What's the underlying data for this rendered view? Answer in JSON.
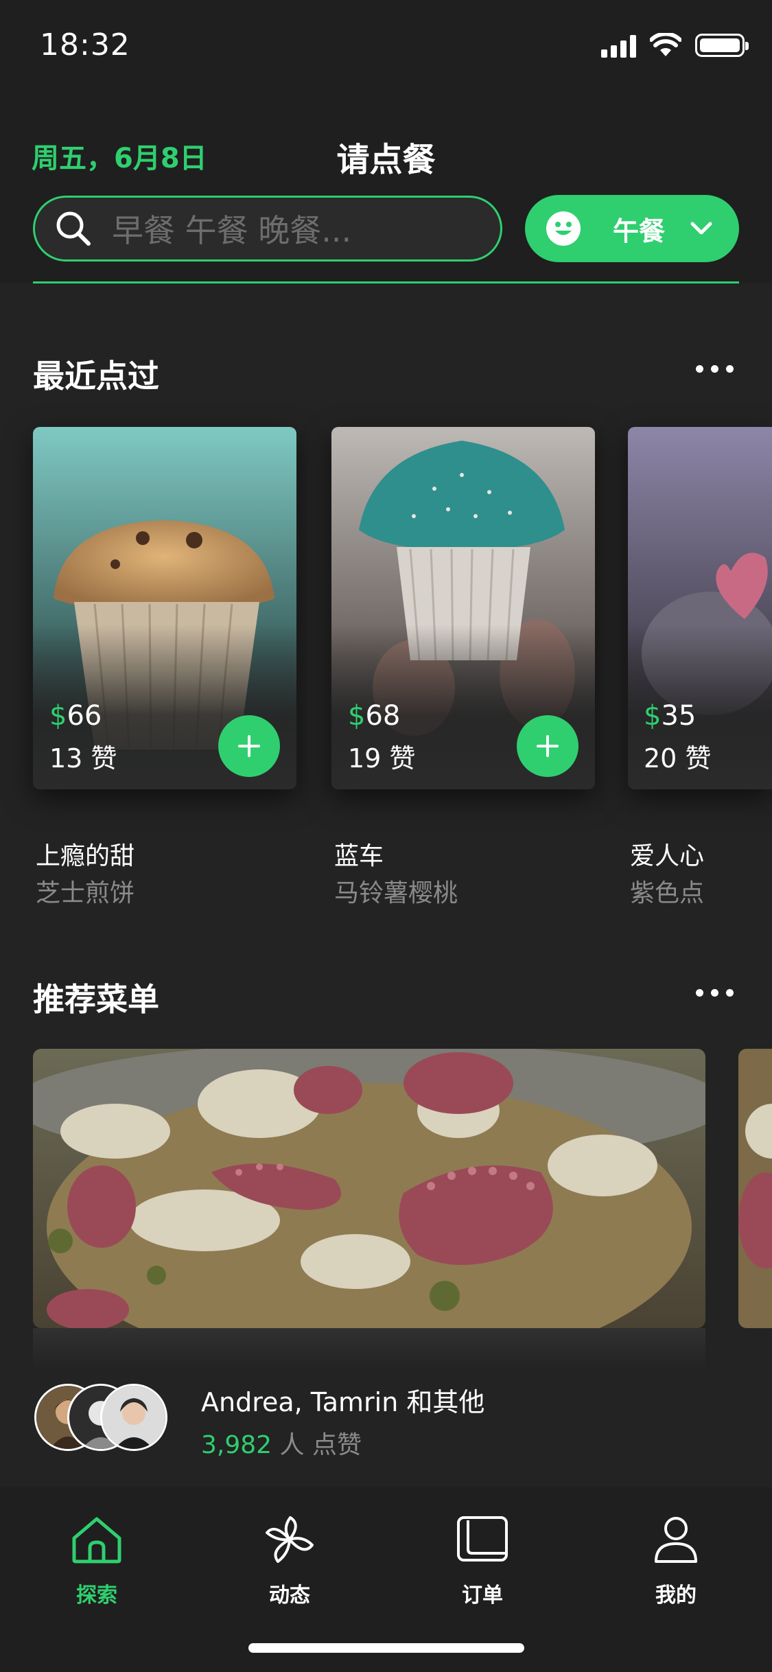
{
  "status_bar": {
    "time": "18:32"
  },
  "header": {
    "date": "周五，6月8日",
    "title": "请点餐"
  },
  "search": {
    "placeholder": "早餐 午餐 晚餐..."
  },
  "meal_selector": {
    "label": "午餐"
  },
  "recent": {
    "title": "最近点过",
    "items": [
      {
        "currency": "$",
        "price": "66",
        "likes": "13 赞",
        "name": "上瘾的甜",
        "sub": "芝士煎饼"
      },
      {
        "currency": "$",
        "price": "68",
        "likes": "19 赞",
        "name": "蓝车",
        "sub": "马铃薯樱桃"
      },
      {
        "currency": "$",
        "price": "35",
        "likes": "20 赞",
        "name": "爱人心",
        "sub": "紫色点"
      }
    ]
  },
  "recommended": {
    "title": "推荐菜单",
    "people": "Andrea, Tamrin 和其他",
    "like_count": "3,982",
    "like_suffix": " 人 点赞"
  },
  "tabs": [
    {
      "label": "探索",
      "icon": "home-icon",
      "active": true
    },
    {
      "label": "动态",
      "icon": "pinwheel-icon",
      "active": false
    },
    {
      "label": "订单",
      "icon": "orders-icon",
      "active": false
    },
    {
      "label": "我的",
      "icon": "profile-icon",
      "active": false
    }
  ],
  "colors": {
    "accent": "#2fcf6f",
    "background": "#232323",
    "top_bar": "#1f1f1f"
  }
}
